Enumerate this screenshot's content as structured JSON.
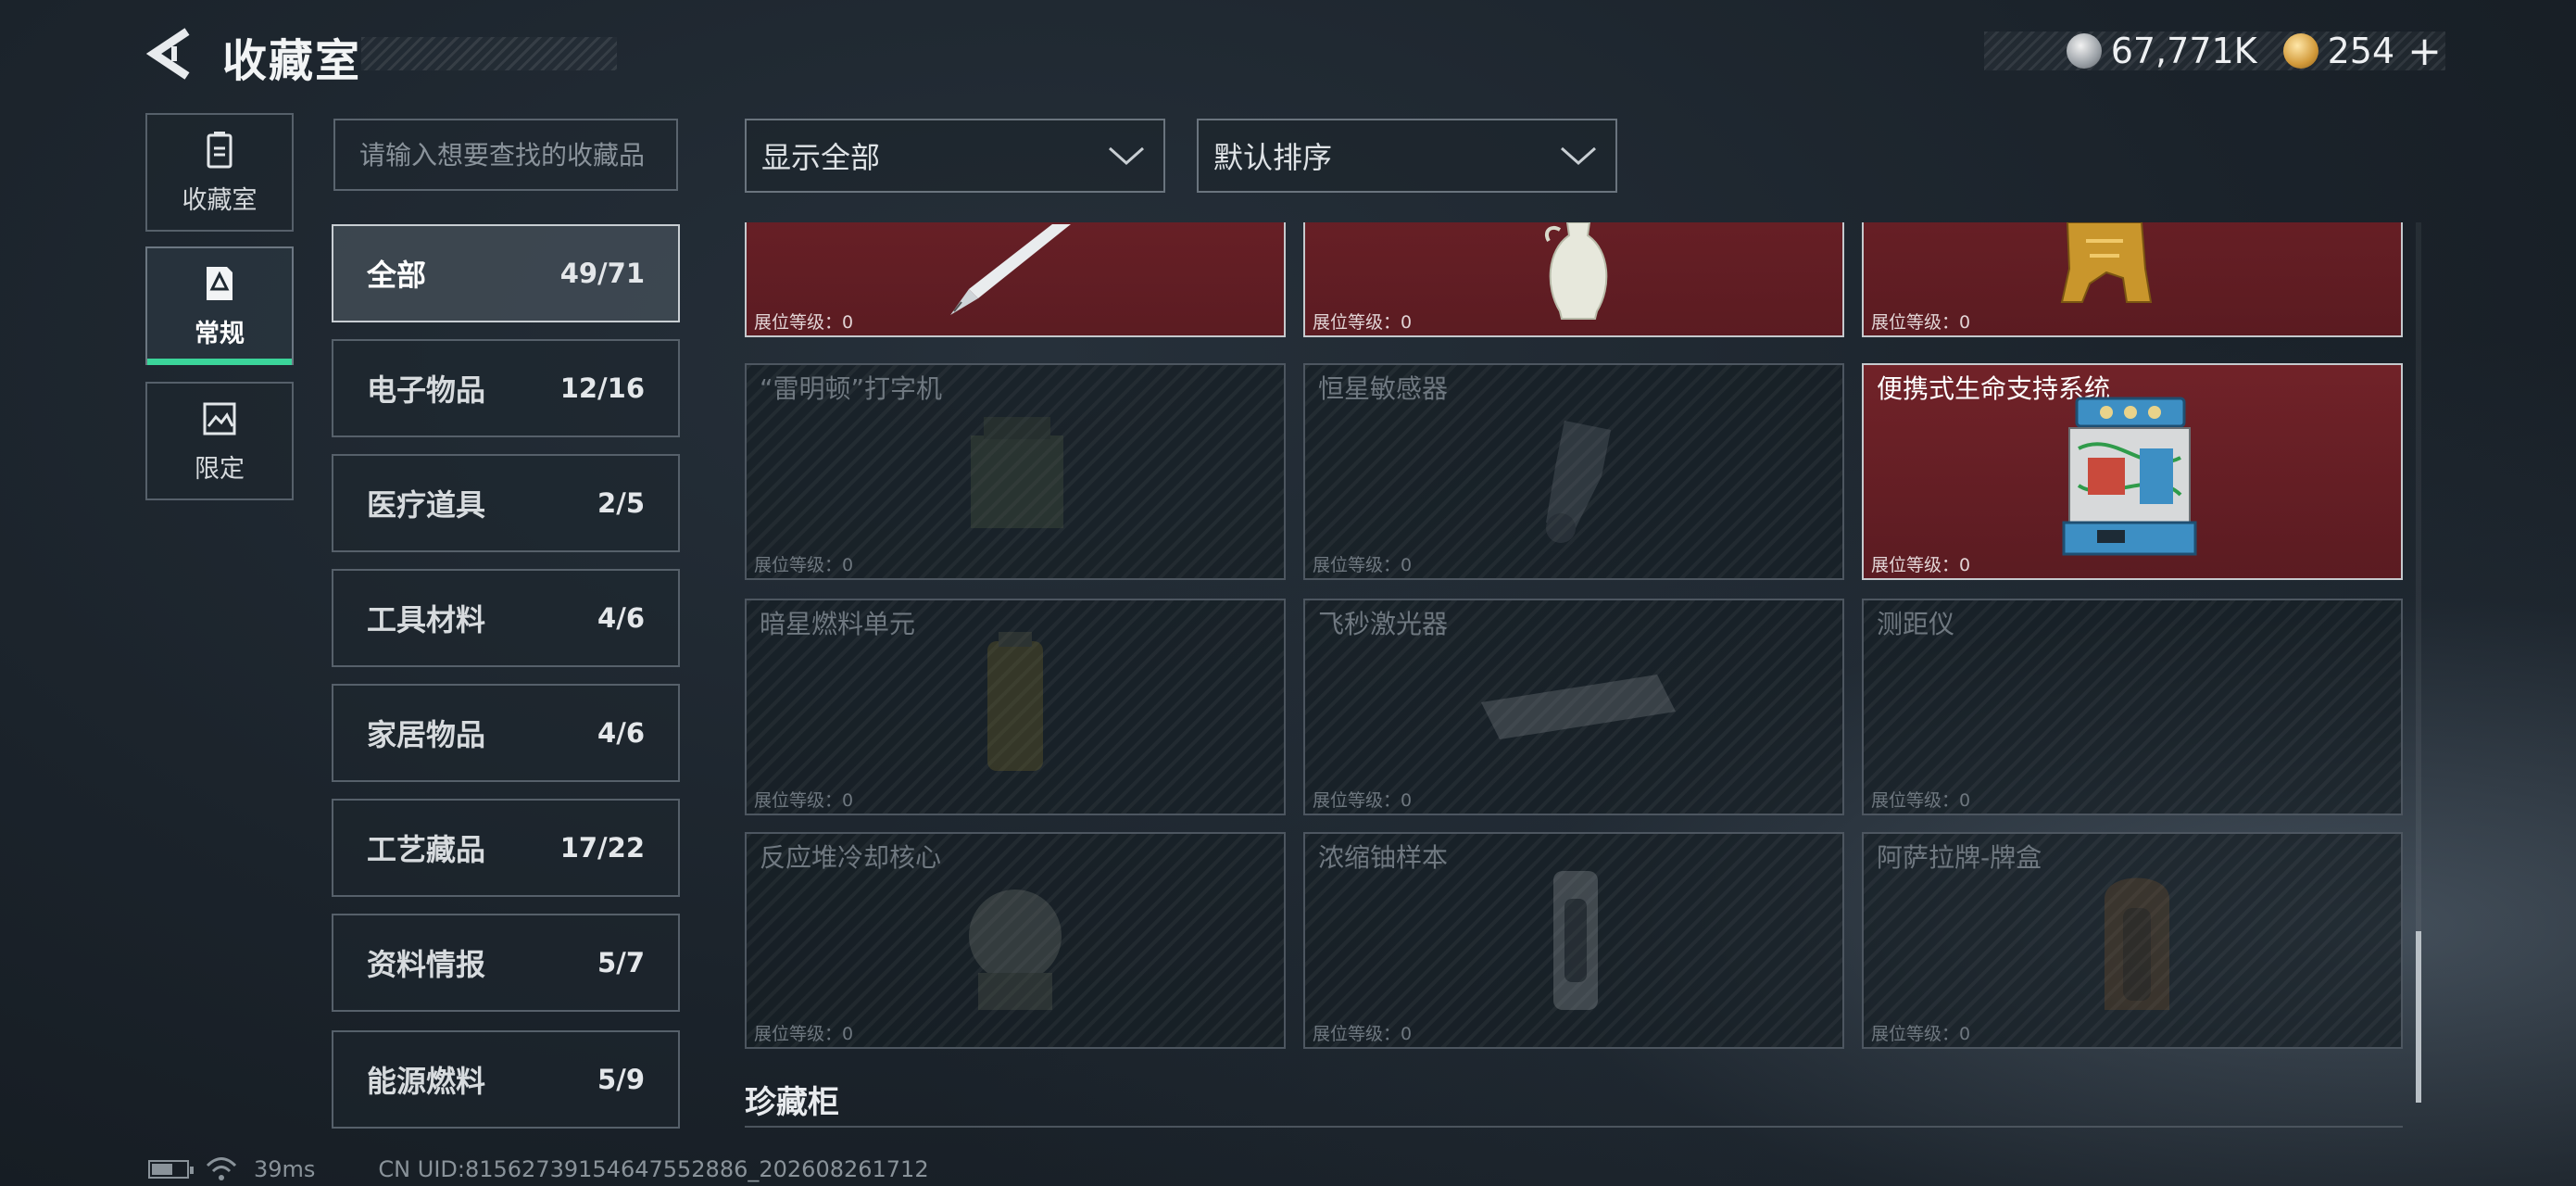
{
  "header": {
    "title": "收藏室",
    "currency": [
      {
        "icon": "silver-coin-icon",
        "value": "67,771K"
      },
      {
        "icon": "gold-coin-icon",
        "value": "254"
      }
    ],
    "add_label": "+"
  },
  "nav": [
    {
      "label": "收藏室",
      "icon": "trash-bin-icon",
      "active": false
    },
    {
      "label": "常规",
      "icon": "document-icon",
      "active": true
    },
    {
      "label": "限定",
      "icon": "image-icon",
      "active": false
    }
  ],
  "search": {
    "placeholder": "请输入想要查找的收藏品",
    "value": ""
  },
  "categories": [
    {
      "name": "全部",
      "count": "49/71",
      "active": true
    },
    {
      "name": "电子物品",
      "count": "12/16"
    },
    {
      "name": "医疗道具",
      "count": "2/5"
    },
    {
      "name": "工具材料",
      "count": "4/6"
    },
    {
      "name": "家居物品",
      "count": "4/6"
    },
    {
      "name": "工艺藏品",
      "count": "17/22"
    },
    {
      "name": "资料情报",
      "count": "5/7"
    },
    {
      "name": "能源燃料",
      "count": "5/9"
    }
  ],
  "filters": {
    "display": "显示全部",
    "sort": "默认排序"
  },
  "items": [
    {
      "name": "",
      "level": "展位等级：0",
      "owned": true,
      "icon": "fountain-pen-icon"
    },
    {
      "name": "",
      "level": "展位等级：0",
      "owned": true,
      "icon": "porcelain-vase-icon"
    },
    {
      "name": "",
      "level": "展位等级：0",
      "owned": true,
      "icon": "golden-statue-icon"
    },
    {
      "name": "“雷明顿”打字机",
      "level": "展位等级：0",
      "owned": false,
      "icon": "typewriter-icon"
    },
    {
      "name": "恒星敏感器",
      "level": "展位等级：0",
      "owned": false,
      "icon": "star-sensor-icon"
    },
    {
      "name": "便携式生命支持系统",
      "level": "展位等级：0",
      "owned": true,
      "icon": "life-support-icon"
    },
    {
      "name": "暗星燃料单元",
      "level": "展位等级：0",
      "owned": false,
      "icon": "fuel-cell-icon"
    },
    {
      "name": "飞秒激光器",
      "level": "展位等级：0",
      "owned": false,
      "icon": "laser-icon"
    },
    {
      "name": "测距仪",
      "level": "展位等级：0",
      "owned": false,
      "icon": "rangefinder-icon"
    },
    {
      "name": "反应堆冷却核心",
      "level": "展位等级：0",
      "owned": false,
      "icon": "reactor-core-icon"
    },
    {
      "name": "浓缩铀样本",
      "level": "展位等级：0",
      "owned": false,
      "icon": "uranium-sample-icon"
    },
    {
      "name": "阿萨拉牌-牌盒",
      "level": "展位等级：0",
      "owned": false,
      "icon": "card-box-icon"
    }
  ],
  "section": {
    "title": "珍藏柜"
  },
  "footer": {
    "ping": "39ms",
    "uid": "CN UID:81562739154647552886_202608261712"
  }
}
